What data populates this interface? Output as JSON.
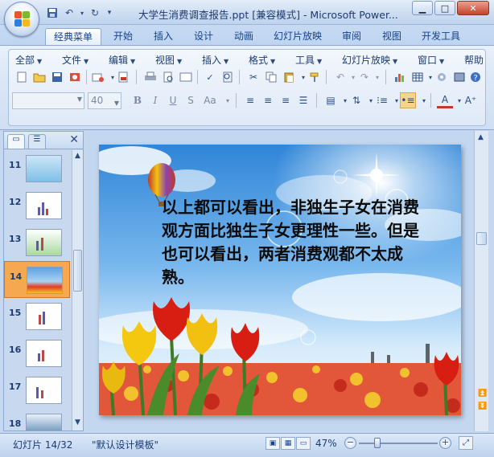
{
  "window": {
    "title": "大学生消费调查报告.ppt [兼容模式] - Microsoft Power...",
    "controls": [
      "minimize-icon",
      "maximize-icon",
      "close-icon"
    ]
  },
  "quick_access": [
    "save-icon",
    "undo-icon",
    "redo-icon",
    "customize-qat-icon"
  ],
  "ribbon_tabs": [
    {
      "label": "经典菜单",
      "active": true
    },
    {
      "label": "开始"
    },
    {
      "label": "插入"
    },
    {
      "label": "设计"
    },
    {
      "label": "动画"
    },
    {
      "label": "幻灯片放映"
    },
    {
      "label": "审阅"
    },
    {
      "label": "视图"
    },
    {
      "label": "开发工具"
    }
  ],
  "classic_menu": [
    "全部",
    "文件",
    "编辑",
    "视图",
    "插入",
    "格式",
    "工具",
    "幻灯片放映",
    "窗口",
    "帮助"
  ],
  "formatting": {
    "font_name": "",
    "font_size_placeholder": "40"
  },
  "slides_panel": {
    "numbers": [
      "11",
      "12",
      "13",
      "14",
      "15",
      "16",
      "17",
      "18"
    ],
    "selected": "14"
  },
  "current_slide": {
    "text": "以上都可以看出，非独生子女在消费观方面比独生子女更理性一些。但是也可以看出，两者消费观都不太成熟。"
  },
  "status": {
    "slide_indicator": "幻灯片 14/32",
    "template_name": "\"默认设计模板\"",
    "zoom_percent": "47%",
    "zoom_level": 0.47
  },
  "colors": {
    "ribbon_blue": "#c5d8ef",
    "selected_thumb": "#f5a850",
    "tab_text": "#15428b"
  }
}
